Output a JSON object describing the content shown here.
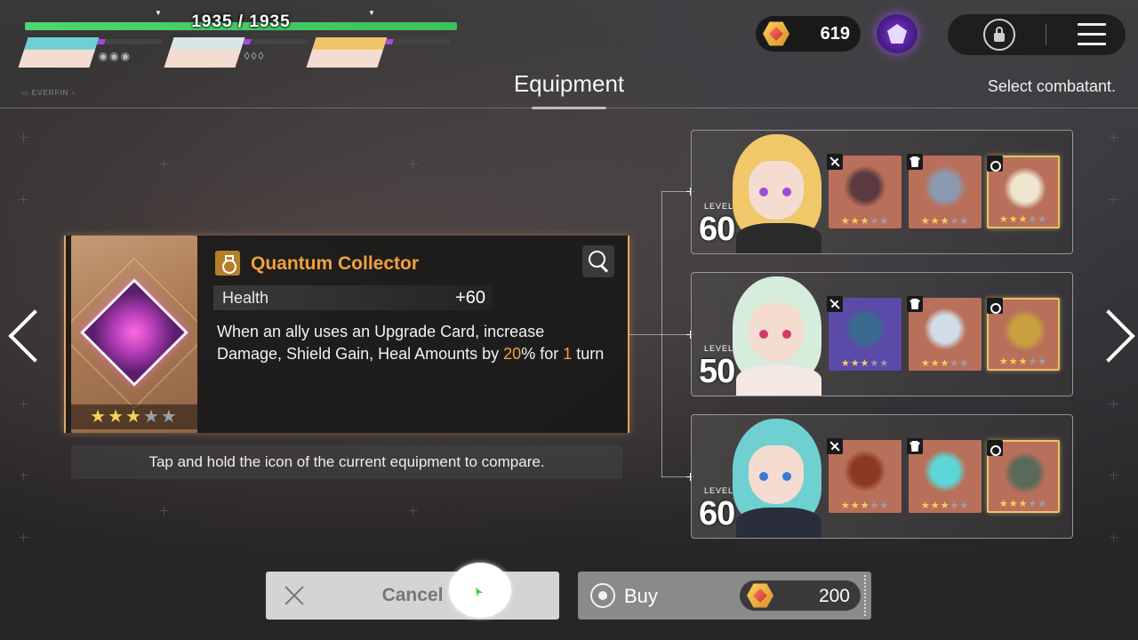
{
  "party": {
    "hp_text": "1935 / 1935",
    "hp_fraction": 1.0,
    "members": [
      {
        "name": "glasses-teal-hair",
        "hair_color": "#6fd0d2",
        "dots": "◉◉◉"
      },
      {
        "name": "silver-hair-red-eyes",
        "hair_color": "#d8e6e6",
        "dots": "◊◊◊"
      },
      {
        "name": "blonde-hair",
        "hair_color": "#f2c46a",
        "dots": ""
      }
    ],
    "brand_tag": "▭ EVERFIN ▫"
  },
  "hud": {
    "currency_value": "619",
    "currency_icon": "gem-icon",
    "premium_icon": "gem-purple-icon",
    "lock_icon": "lock-icon",
    "menu_icon": "hamburger-menu-icon"
  },
  "header": {
    "title": "Equipment",
    "hint": "Select combatant."
  },
  "item": {
    "type_icon": "ring-icon",
    "name": "Quantum Collector",
    "stat_label": "Health",
    "stat_value": "+60",
    "rarity_stars": 3,
    "max_stars": 5,
    "desc_part1": "When an ally uses an Upgrade Card, increase Damage, Shield Gain, Heal Amounts by ",
    "desc_percent": "20",
    "desc_part2": "% for ",
    "desc_turns": "1",
    "desc_part3": " turn",
    "accent_color": "#f0a13c"
  },
  "compare_hint": "Tap and hold the icon of the current equipment to compare.",
  "combatants": [
    {
      "level_label": "LEVEL",
      "level": "60",
      "hair_color": "#f0c86a",
      "eye_color": "#9a4fd4",
      "body_color": "#2a2a2a",
      "slots": [
        {
          "type": "weapon",
          "icon": "sword-icon",
          "bg": "#b9705a",
          "item_color": "#5a3a40",
          "stars": 3
        },
        {
          "type": "armor",
          "icon": "armor-icon",
          "bg": "#b9705a",
          "item_color": "#8a9ab0",
          "stars": 3
        },
        {
          "type": "accessory",
          "icon": "ring-icon",
          "bg": "#b9705a",
          "item_color": "#f0e6d0",
          "stars": 3
        }
      ]
    },
    {
      "level_label": "LEVEL",
      "level": "50",
      "hair_color": "#d6ecdc",
      "eye_color": "#d23a6a",
      "body_color": "#f4e8e2",
      "slots": [
        {
          "type": "weapon",
          "icon": "sword-icon",
          "bg": "#5b4aa8",
          "item_color": "#3a6a90",
          "stars": 3
        },
        {
          "type": "armor",
          "icon": "armor-icon",
          "bg": "#b9705a",
          "item_color": "#d0dde6",
          "stars": 3
        },
        {
          "type": "accessory",
          "icon": "ring-icon",
          "bg": "#b9705a",
          "item_color": "#c9a040",
          "stars": 3
        }
      ]
    },
    {
      "level_label": "LEVEL",
      "level": "60",
      "hair_color": "#6fd0d2",
      "eye_color": "#3a7ad0",
      "body_color": "#2a2d3a",
      "slots": [
        {
          "type": "weapon",
          "icon": "sword-icon",
          "bg": "#b9705a",
          "item_color": "#8a3a20",
          "stars": 3
        },
        {
          "type": "armor",
          "icon": "armor-icon",
          "bg": "#b9705a",
          "item_color": "#5cd6d6",
          "stars": 3
        },
        {
          "type": "accessory",
          "icon": "ring-icon",
          "bg": "#b9705a",
          "item_color": "#5a6a5a",
          "stars": 3
        }
      ]
    }
  ],
  "actions": {
    "cancel_label": "Cancel",
    "buy_label": "Buy",
    "price": "200"
  }
}
